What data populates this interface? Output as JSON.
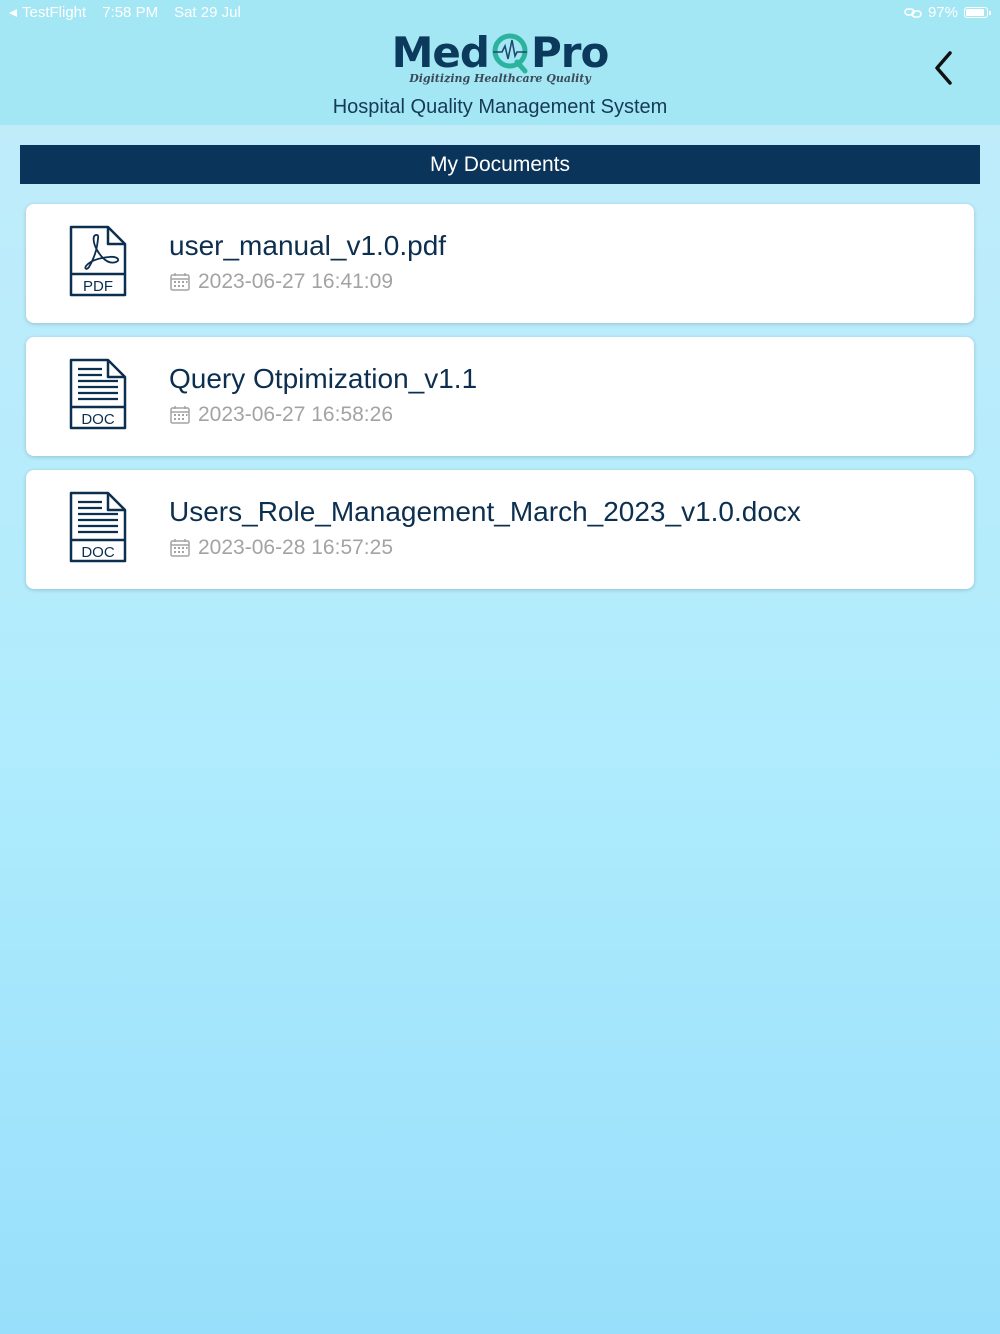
{
  "status_bar": {
    "app": "TestFlight",
    "time": "7:58 PM",
    "date": "Sat 29 Jul",
    "battery": "97%",
    "battery_level": 0.97
  },
  "header": {
    "logo_left": "Med",
    "logo_right": "Pro",
    "tagline": "Digitizing Healthcare Quality",
    "subtitle": "Hospital Quality Management System",
    "back_icon": "chevron-left-icon"
  },
  "section": {
    "title": "My Documents"
  },
  "documents": [
    {
      "icon": "pdf-file-icon",
      "type": "PDF",
      "name": "user_manual_v1.0.pdf",
      "date": "2023-06-27 16:41:09"
    },
    {
      "icon": "doc-file-icon",
      "type": "DOC",
      "name": "Query Otpimization_v1.1",
      "date": "2023-06-27 16:58:26"
    },
    {
      "icon": "doc-file-icon",
      "type": "DOC",
      "name": "Users_Role_Management_March_2023_v1.0.docx",
      "date": "2023-06-28 16:57:25"
    }
  ],
  "colors": {
    "header_bg": "#a3e6f4",
    "section_bar": "#0a3459",
    "text_dark": "#0d2f4f",
    "date_gray": "#a3a3a3",
    "logo_teal": "#2bb39d"
  }
}
